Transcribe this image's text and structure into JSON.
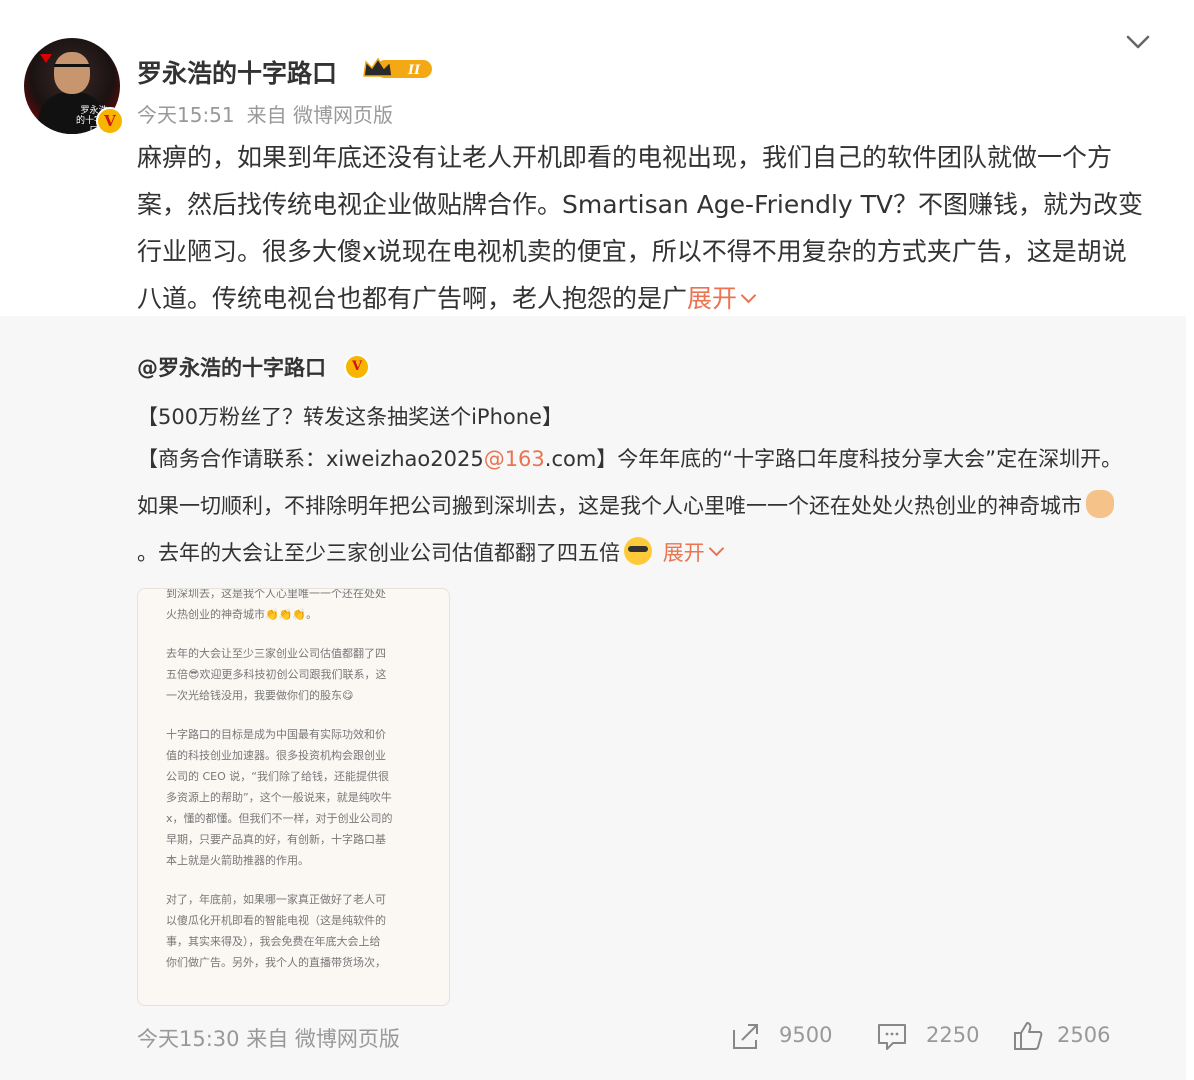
{
  "post": {
    "author": "罗永浩的十字路口",
    "level_badge": "II",
    "avatar_caption": "罗永浩\n的十字路口",
    "verified_mark": "V",
    "time": "今天15:51",
    "source": "来自 微博网页版",
    "text": "麻痹的，如果到年底还没有让老人开机即看的电视出现，我们自己的软件团队就做一个方案，然后找传统电视企业做贴牌合作。Smartisan Age-Friendly TV？不图赚钱，就为改变行业陋习。很多大傻x说现在电视机卖的便宜，所以不得不用复杂的方式夹广告，这是胡说八道。传统电视台也都有广告啊，老人抱怨的是广",
    "expand_label": "展开"
  },
  "repost": {
    "author": "@罗永浩的十字路口",
    "verified_mark": "V",
    "line1": "【500万粉丝了？转发这条抽奖送个iPhone】",
    "body_prefix": "【商务合作请联系：xiweizhao2025",
    "body_link": "@163",
    "body_mid": ".com】今年年底的“十字路口年度科技分享大会”定在深圳开。如果一切顺利，不排除明年把公司搬到深圳去，这是我个人心里唯一一个还在处处火热创业的神奇城市",
    "body_after_emoji": "。去年的大会让至少三家创业公司估值都翻了四五倍",
    "expand_label": "展开",
    "emoji_fist": "fist-emoji",
    "emoji_cool": "cool-emoji",
    "image_lines": [
      "到深圳去，这是我个人心里唯一一个还在处处",
      "火热创业的神奇城市👏👏👏。",
      "",
      "去年的大会让至少三家创业公司估值都翻了四",
      "五倍😎欢迎更多科技初创公司跟我们联系，这",
      "一次光给钱没用，我要做你们的股东😋",
      "",
      "十字路口的目标是成为中国最有实际功效和价",
      "值的科技创业加速器。很多投资机构会跟创业",
      "公司的 CEO 说，“我们除了给钱，还能提供很",
      "多资源上的帮助”，这个一般说来，就是纯吹牛",
      "x，懂的都懂。但我们不一样，对于创业公司的",
      "早期，只要产品真的好，有创新，十字路口基",
      "本上就是火箭助推器的作用。",
      "",
      "对了，年底前，如果哪一家真正做好了老人可",
      "以傻瓜化开机即看的智能电视（这是纯软件的",
      "事，其实来得及），我会免费在年底大会上给",
      "你们做广告。另外，我个人的直播带货场次，"
    ],
    "time": "今天15:30",
    "source": "来自",
    "client": "微博网页版",
    "repost_count": "9500",
    "comment_count": "2250",
    "like_count": "2506"
  },
  "colors": {
    "link": "#eb7350",
    "meta": "#999999",
    "repost_bg": "#f7f7f7"
  }
}
